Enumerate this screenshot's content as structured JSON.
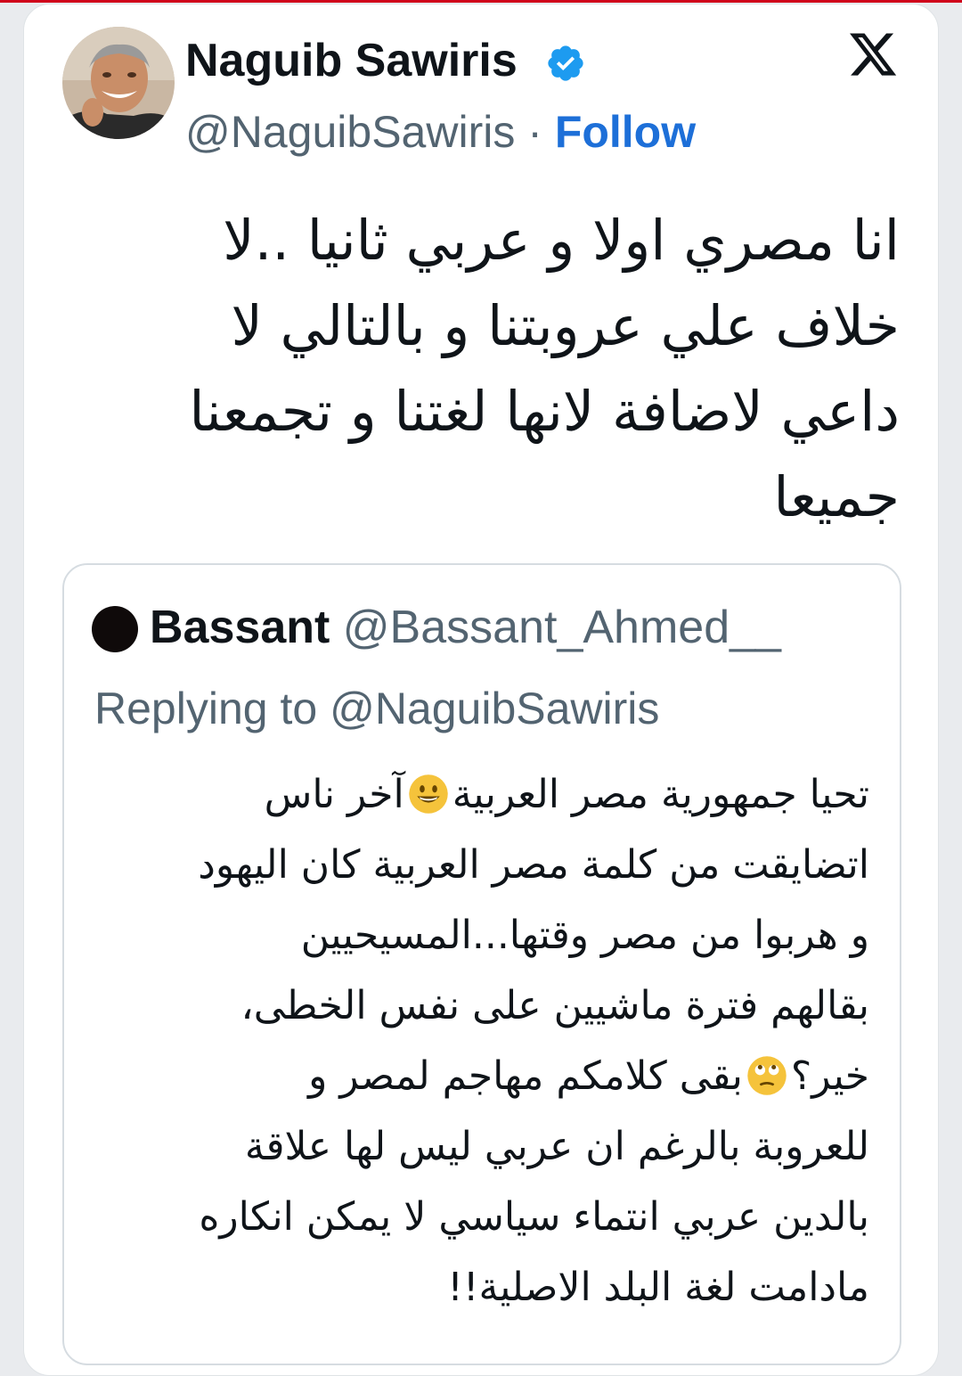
{
  "tweet": {
    "author": {
      "name": "Naguib Sawiris",
      "handle": "@NaguibSawiris",
      "separator": "·",
      "follow_label": "Follow",
      "verified": true
    },
    "lines": [
      "انا مصري اولا و عربي ثانيا ..لا",
      "خلاف علي عروبتنا و بالتالي لا",
      "داعي لاضافة لانها لغتنا و تجمعنا",
      "جميعا"
    ]
  },
  "quoted_tweet": {
    "author_name": "Bassant",
    "author_handle": "@Bassant_Ahmed__",
    "replying_prefix": "Replying to",
    "replying_handle": "@NaguibSawiris",
    "lines": {
      "l1_before": "تحيا جمهورية مصر العربية",
      "l1_after": "آخر ناس",
      "l2": "اتضايقت من كلمة مصر العربية كان اليهود",
      "l3": "و هربوا من مصر وقتها...المسيحيين",
      "l4": "بقالهم فترة ماشيين على نفس الخطى،",
      "l5_before": "خير؟",
      "l5_after": "بقى كلامكم مهاجم لمصر و",
      "l6": "للعروبة بالرغم ان عربي ليس لها علاقة",
      "l7": "بالدين عربي انتماء سياسي لا يمكن انكاره",
      "l8": "مادامت لغة البلد الاصلية!!"
    },
    "emoji": [
      "grinning-face",
      "face-with-rolling-eyes"
    ]
  },
  "colors": {
    "follow": "#1d6fd8",
    "verified": "#1d9bf0",
    "secondary_text": "#536471",
    "primary_text": "#0f1419"
  }
}
